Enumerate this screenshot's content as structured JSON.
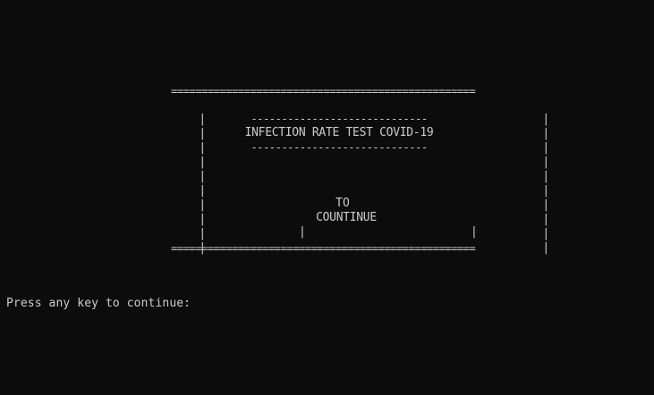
{
  "console": {
    "border_top": "==================================================",
    "border_bottom": "==================================================",
    "side_bar": "|",
    "title_rule_top": "-----------------------------",
    "title": "INFECTION RATE TEST COVID-19",
    "title_rule_bottom": "-----------------------------",
    "button_line1": "TO",
    "button_line2": "COUNTINUE",
    "prompt": "Press any key to continue:"
  },
  "colors": {
    "background": "#0c0c0c",
    "text": "#cccccc"
  }
}
